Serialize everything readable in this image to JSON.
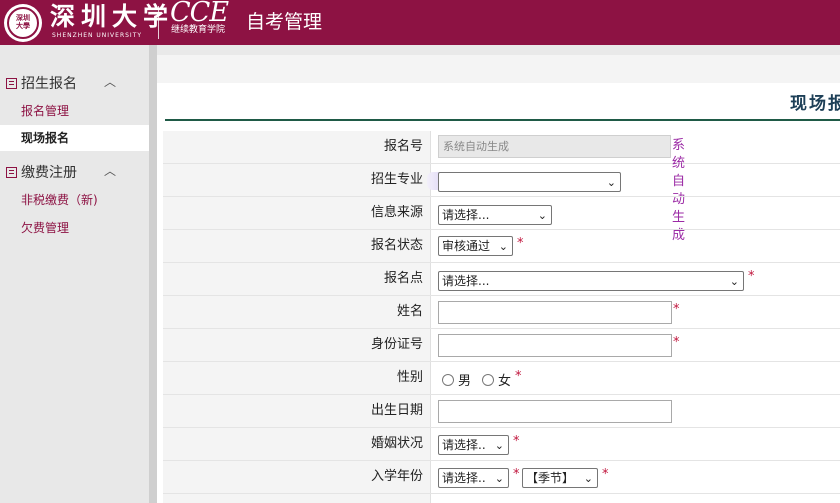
{
  "header": {
    "university_cn": "深圳大学",
    "university_en": "SHENZHEN UNIVERSITY",
    "seal_text": "深圳大學",
    "cce_logo": "CCE",
    "cce_name": "继续教育学院",
    "system_title": "自考管理",
    "brand_color": "#8d1243"
  },
  "sidebar": {
    "groups": [
      {
        "label": "招生报名",
        "expanded": true,
        "icon": "list-icon",
        "items": [
          {
            "label": "报名管理"
          },
          {
            "label": "现场报名",
            "active": true
          }
        ]
      },
      {
        "label": "缴费注册",
        "expanded": true,
        "icon": "list-icon",
        "items": [
          {
            "label": "非税缴费（新)"
          },
          {
            "label": "欠费管理"
          }
        ]
      }
    ]
  },
  "main": {
    "page_title": "现场报名",
    "form": {
      "reg_no": {
        "label": "报名号",
        "placeholder": "系统自动生成",
        "note": "系统自动生成"
      },
      "major": {
        "label": "招生专业",
        "value": ""
      },
      "source": {
        "label": "信息来源",
        "value": "请选择..."
      },
      "status": {
        "label": "报名状态",
        "value": "审核通过",
        "required": "*"
      },
      "site": {
        "label": "报名点",
        "value": "请选择...",
        "required": "*"
      },
      "name": {
        "label": "姓名",
        "value": "",
        "required": "*"
      },
      "id_card": {
        "label": "身份证号",
        "value": "",
        "required": "*"
      },
      "gender": {
        "label": "性别",
        "options": [
          "男",
          "女"
        ],
        "required": "*"
      },
      "birth": {
        "label": "出生日期",
        "value": ""
      },
      "marital": {
        "label": "婚姻状况",
        "value": "请选择..",
        "required": "*"
      },
      "year": {
        "label": "入学年份",
        "value": "请选择..",
        "required": "*",
        "season": "【季节】",
        "season_required": "*"
      }
    }
  }
}
